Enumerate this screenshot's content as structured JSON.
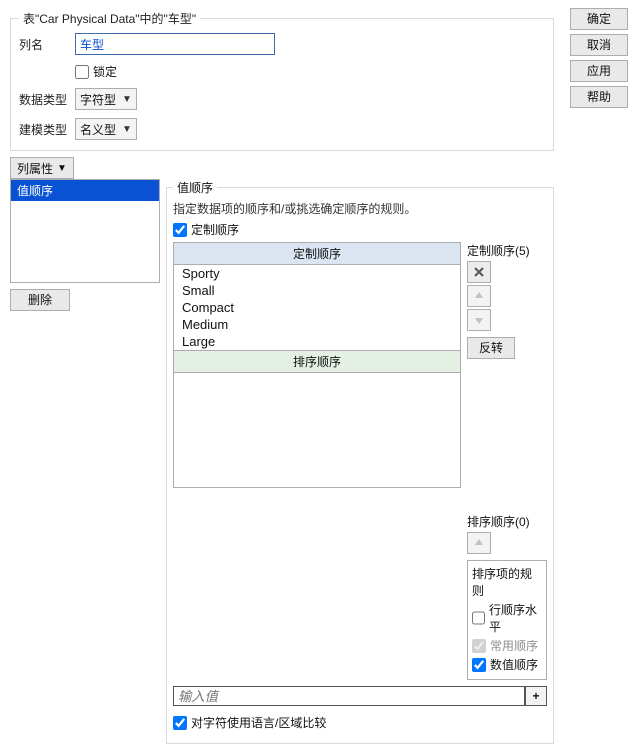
{
  "sidebar_buttons": {
    "ok": "确定",
    "cancel": "取消",
    "apply": "应用",
    "help": "帮助"
  },
  "box_legend": "表\"Car Physical Data\"中的\"车型\"",
  "labels": {
    "col_name": "列名",
    "lock": "锁定",
    "data_type": "数据类型",
    "model_type": "建模类型",
    "col_prop": "列属性",
    "delete": "删除"
  },
  "field_values": {
    "col_name": "车型",
    "data_type": "字符型",
    "model_type": "名义型"
  },
  "properties_list": [
    "值顺序"
  ],
  "value_order": {
    "legend": "值顺序",
    "desc": "指定数据项的顺序和/或挑选确定顺序的规则。",
    "custom_check": "定制顺序",
    "custom_header": "定制顺序",
    "sort_header": "排序顺序",
    "custom_items": [
      "Sporty",
      "Small",
      "Compact",
      "Medium",
      "Large"
    ],
    "side": {
      "custom_title": "定制顺序(5)",
      "sort_title": "排序顺序(0)",
      "reverse": "反转",
      "rules_title": "排序项的规则",
      "rule_rowhoriz": "行顺序水平",
      "rule_common": "常用顺序",
      "rule_numeric": "数值顺序"
    },
    "value_input_placeholder": "输入值",
    "plus": "+",
    "locale_compare": "对字符使用语言/区域比较"
  }
}
